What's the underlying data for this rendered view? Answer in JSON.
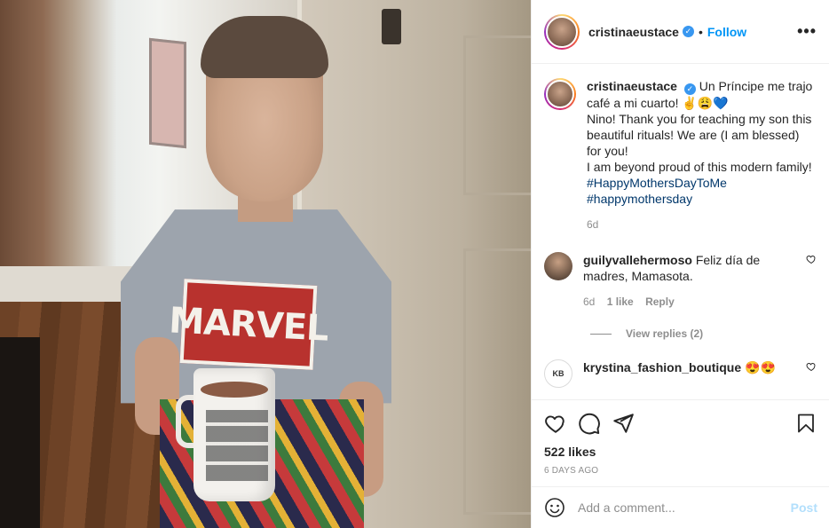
{
  "post": {
    "image_alt": "Boy in Marvel t-shirt holding a coffee mug",
    "shirt_text": "MARVEL"
  },
  "header": {
    "username": "cristinaeustace",
    "verified_glyph": "✓",
    "separator": "•",
    "follow_label": "Follow",
    "more_icon": "•••"
  },
  "caption": {
    "username": "cristinaeustace",
    "lines": [
      "Un Príncipe me trajo café a mi cuarto! ✌😩💙",
      "Nino! Thank you for teaching my son this beautiful rituals! We are (I am blessed) for you!",
      "I am beyond proud of this modern family!"
    ],
    "hashtags": [
      "#HappyMothersDayToMe",
      "#happymothersday"
    ],
    "age": "6d"
  },
  "comments": [
    {
      "username": "guilyvallehermoso",
      "text": "Feliz día de madres, Mamasota.",
      "age": "6d",
      "likes": "1 like",
      "reply_label": "Reply",
      "view_replies": "View replies (2)"
    },
    {
      "username": "krystina_fashion_boutique",
      "avatar_text": "KB",
      "text": "😍😍"
    }
  ],
  "actions": {
    "likes": "522 likes",
    "date": "6 DAYS AGO"
  },
  "add_comment": {
    "placeholder": "Add a comment...",
    "post_label": "Post"
  },
  "icons": {
    "like": "heart-icon",
    "comment": "comment-icon",
    "share": "share-icon",
    "save": "bookmark-icon",
    "emoji": "emoji-icon"
  },
  "colors": {
    "accent": "#0095f6",
    "hashtag": "#00376b",
    "muted": "#8e8e8e",
    "post_disabled": "#b2dffc"
  }
}
